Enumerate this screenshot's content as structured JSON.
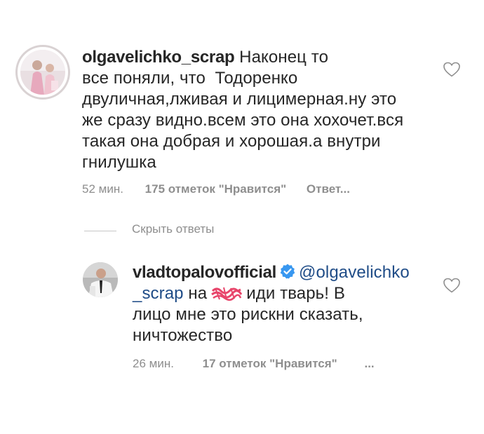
{
  "comments": [
    {
      "username": "olgavelichko_scrap",
      "text_lines": [
        "Наконец то",
        "все поняли, что  Тодоренко",
        "двуличная,лживая и лицимерная.ну это",
        "же сразу видно.всем это она хохочет.вся",
        "такая она добрая и хорошая.а внутри",
        "гнилушка"
      ],
      "time": "52 мин.",
      "likes": "175 отметок \"Нравится\"",
      "reply": "Ответ..."
    },
    {
      "username": "vladtopalovofficial",
      "mention_part1": "@olgavelichko",
      "mention_part2": "_scrap",
      "text_after_mention": "на",
      "text_after_censor": "иди тварь! В",
      "text_lines": [
        "лицо мне это рискни сказать,",
        "ничтожество"
      ],
      "time": "26 мин.",
      "likes": "17 отметок \"Нравится\"",
      "more": "..."
    }
  ],
  "hide_replies": "Скрыть ответы",
  "colors": {
    "text": "#262626",
    "meta": "#8e8e8e",
    "mention": "#1f4c87",
    "verified": "#3897f0",
    "censor": "#e8456b"
  }
}
